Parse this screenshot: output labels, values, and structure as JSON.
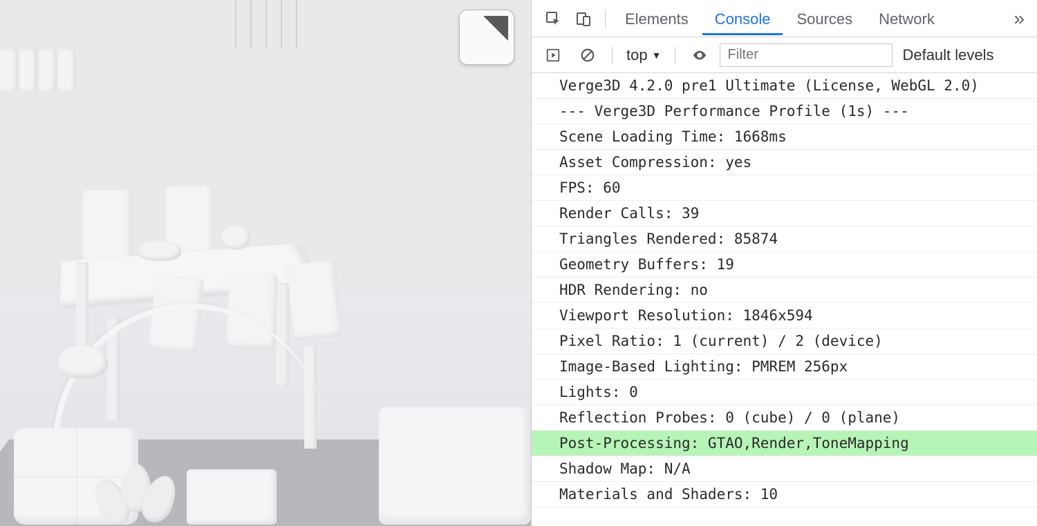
{
  "devtools": {
    "tabs": [
      "Elements",
      "Console",
      "Sources",
      "Network"
    ],
    "active_tab": "Console",
    "more_glyph": "»"
  },
  "toolbar": {
    "context_label": "top",
    "context_arrow": "▼",
    "filter_placeholder": "Filter",
    "levels_label": "Default levels"
  },
  "console": {
    "logs": [
      {
        "text": "Verge3D 4.2.0 pre1 Ultimate (License, WebGL 2.0)",
        "highlight": false
      },
      {
        "text": "--- Verge3D Performance Profile (1s) ---",
        "highlight": false
      },
      {
        "text": "Scene Loading Time: 1668ms",
        "highlight": false
      },
      {
        "text": "Asset Compression: yes",
        "highlight": false
      },
      {
        "text": "FPS: 60",
        "highlight": false
      },
      {
        "text": "Render Calls: 39",
        "highlight": false
      },
      {
        "text": "Triangles Rendered: 85874",
        "highlight": false
      },
      {
        "text": "Geometry Buffers: 19",
        "highlight": false
      },
      {
        "text": "HDR Rendering: no",
        "highlight": false
      },
      {
        "text": "Viewport Resolution: 1846x594",
        "highlight": false
      },
      {
        "text": "Pixel Ratio: 1 (current) / 2 (device)",
        "highlight": false
      },
      {
        "text": "Image-Based Lighting: PMREM 256px",
        "highlight": false
      },
      {
        "text": "Lights: 0",
        "highlight": false
      },
      {
        "text": "Reflection Probes: 0 (cube) / 0 (plane)",
        "highlight": false
      },
      {
        "text": "Post-Processing: GTAO,Render,ToneMapping",
        "highlight": true
      },
      {
        "text": "Shadow Map: N/A",
        "highlight": false
      },
      {
        "text": "Materials and Shaders: 10",
        "highlight": false
      }
    ]
  },
  "icons": {
    "inspect": "inspect-icon",
    "device": "device-icon",
    "play": "play-icon",
    "clear": "clear-icon",
    "eye": "eye-icon"
  }
}
